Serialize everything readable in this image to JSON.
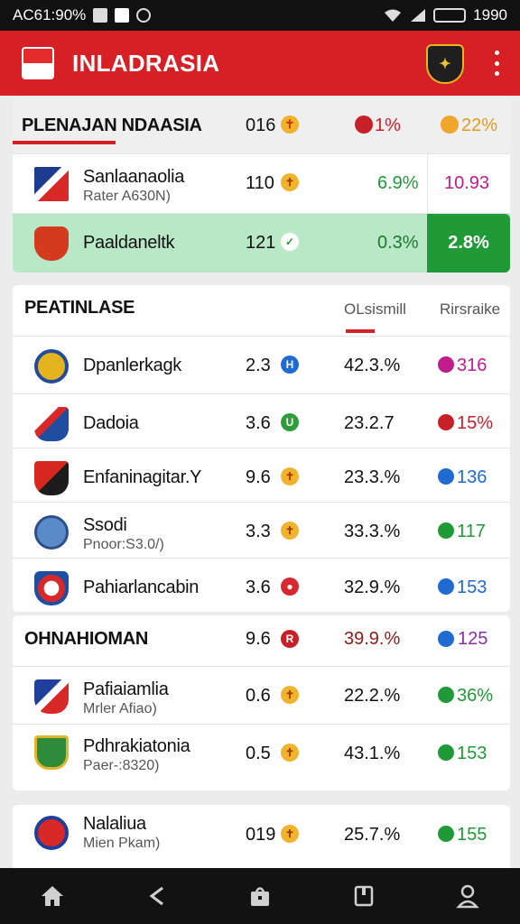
{
  "status_bar": {
    "left_text": "AC61:90%",
    "right_text": "1990"
  },
  "app_bar": {
    "title": "INLADRASIA"
  },
  "section1": {
    "title": "PLENAJAN NDAASIA",
    "col_a": "016",
    "col_b": "1%",
    "col_c": "22%",
    "rows": [
      {
        "name": "Sanlaanaolia",
        "sub": "Rater A630N)",
        "num": "110",
        "pct": "6.9%",
        "right": "10.93"
      },
      {
        "name": "Paaldaneltk",
        "sub": "",
        "num": "121",
        "pct": "0.3%",
        "right": "2.8%"
      }
    ]
  },
  "section2": {
    "title": "PEATINLASE",
    "col_a": "OLsismill",
    "col_b": "Rirsraike",
    "rows": [
      {
        "name": "Dpanlerkagk",
        "sub": "",
        "num": "2.3",
        "pct": "42.3.%",
        "right": "316"
      },
      {
        "name": "Dadoia",
        "sub": "",
        "num": "3.6",
        "pct": "23.2.7",
        "right": "15%"
      },
      {
        "name": "Enfaninagitar.Y",
        "sub": "",
        "num": "9.6",
        "pct": "23.3.%",
        "right": "136"
      },
      {
        "name": "Ssodi",
        "sub": "Pnoor:S3.0/)",
        "num": "3.3",
        "pct": "33.3.%",
        "right": "117"
      },
      {
        "name": "Pahiarlancabin",
        "sub": "",
        "num": "3.6",
        "pct": "32.9.%",
        "right": "153"
      }
    ]
  },
  "section3": {
    "title": "OHNAHIOMAN",
    "num": "9.6",
    "pct": "39.9.%",
    "right": "125",
    "rows": [
      {
        "name": "Pafiaiamlia",
        "sub": "Mrler Afiao)",
        "num": "0.6",
        "pct": "22.2.%",
        "right": "36%"
      },
      {
        "name": "Pdhrakiatonia",
        "sub": "Paer-:8320)",
        "num": "0.5",
        "pct": "43.1.%",
        "right": "153"
      }
    ]
  },
  "section4": {
    "rows": [
      {
        "name": "Nalaliua",
        "sub": "Mien Pkam)",
        "num": "019",
        "pct": "25.7.%",
        "right": "155"
      }
    ]
  },
  "colors": {
    "brand_red": "#d71f26",
    "up_green": "#1f9a37"
  }
}
